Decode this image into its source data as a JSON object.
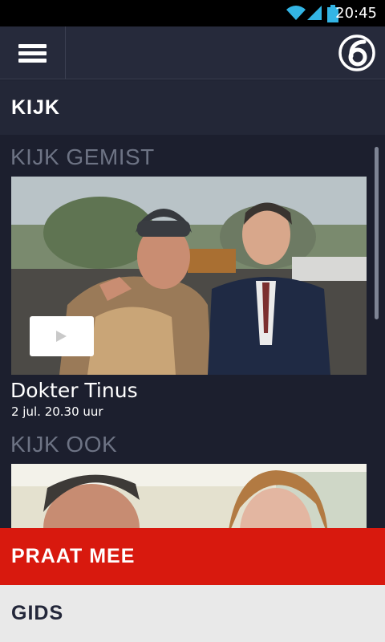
{
  "status_bar": {
    "time": "20:45"
  },
  "header": {
    "menu_icon": "hamburger-menu-icon",
    "logo_icon": "sbs6-logo-icon"
  },
  "section": {
    "title": "KIJK"
  },
  "kijk_gemist": {
    "heading": "KIJK GEMIST",
    "featured": {
      "title": "Dokter Tinus",
      "date": "2 jul. 20.30 uur"
    }
  },
  "kijk_ook": {
    "heading": "KIJK OOK"
  },
  "bottom_nav": {
    "praat_mee": "PRAAT MEE",
    "gids": "GIDS"
  },
  "colors": {
    "accent_red": "#d8190e",
    "header_bg": "#262a3b",
    "content_bg": "#1c1f2e"
  }
}
